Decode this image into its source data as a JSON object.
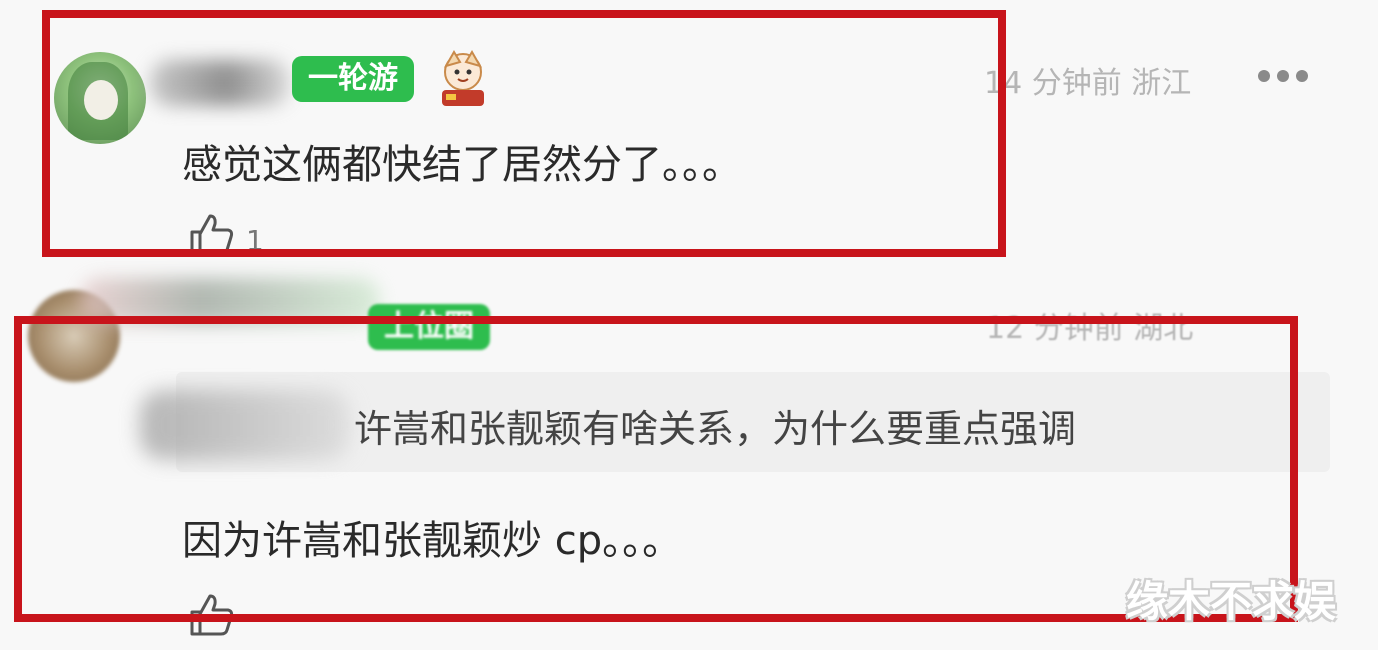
{
  "comments": [
    {
      "badge": "一轮游",
      "time": "14 分钟前",
      "location": "浙江",
      "text": "感觉这俩都快结了居然分了。。。",
      "likes": "1"
    },
    {
      "badge": "上位圈",
      "time": "12 分钟前",
      "location": "湖北",
      "quote": "许嵩和张靓颖有啥关系，为什么要重点强调",
      "text": "因为许嵩和张靓颖炒 cp。。。"
    }
  ],
  "watermark": "缘木不求娱",
  "colors": {
    "highlight_frame": "#c8141b",
    "badge_green": "#2ebd4e",
    "meta_gray": "#b5b5b5"
  },
  "icons": {
    "more": "more-dots-icon",
    "like": "thumbs-up-icon"
  }
}
